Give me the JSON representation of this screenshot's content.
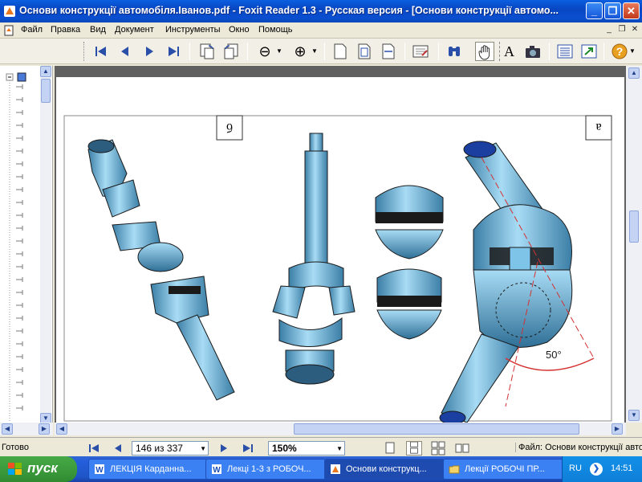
{
  "window": {
    "title": "Основи конструкції автомобіля.Іванов.pdf - Foxit Reader 1.3 - Русская версия  - [Основи конструкції автомо...",
    "minimize_glyph": "_",
    "maximize_glyph": "❐",
    "close_glyph": "✕"
  },
  "menu": {
    "items": [
      "Файл",
      "Правка",
      "Вид",
      "Документ",
      "Инструменты",
      "Окно",
      "Помощь"
    ],
    "mdi_minimize": "_",
    "mdi_restore": "❐",
    "mdi_close": "✕"
  },
  "toolbar": {
    "buttons": [
      "first-page-icon",
      "previous-page-icon",
      "next-page-icon",
      "last-page-icon",
      "rotate-left-icon",
      "rotate-right-icon",
      "zoom-out-icon",
      "zoom-in-icon",
      "actual-size-icon",
      "fit-page-icon",
      "fit-width-icon",
      "annotate-icon",
      "find-icon",
      "hand-tool-icon",
      "select-text-icon",
      "snapshot-icon",
      "bookmarks-icon",
      "export-icon",
      "help-icon"
    ],
    "zoom_out_glyph": "⊖",
    "zoom_in_glyph": "⊕",
    "help_glyph": "?",
    "text_tool_glyph": "A"
  },
  "document": {
    "page_label": "б",
    "figure_label": "а",
    "angle_label": "50°",
    "colors": {
      "part_fill": "#7ec3e8",
      "part_dark": "#3b7ea6",
      "ink": "#1a1a1a",
      "accent": "#d43030"
    }
  },
  "status": {
    "ready": "Готово",
    "page_indicator": "146 из 337",
    "zoom": "150%",
    "file": "Файл: Основи конструкції автомобіля"
  },
  "taskbar": {
    "start_label": "пуск",
    "tasks": [
      {
        "label": "ЛЕКЦІЯ Карданна...",
        "icon": "word-icon"
      },
      {
        "label": "Лекці 1-3 з РОБОЧ...",
        "icon": "word-icon"
      },
      {
        "label": "Основи конструкц...",
        "icon": "foxit-icon"
      },
      {
        "label": "Лекції РОБОЧІ ПР...",
        "icon": "folder-icon"
      }
    ],
    "language": "RU",
    "clock": "14:51",
    "tray_glyph": "❯"
  }
}
